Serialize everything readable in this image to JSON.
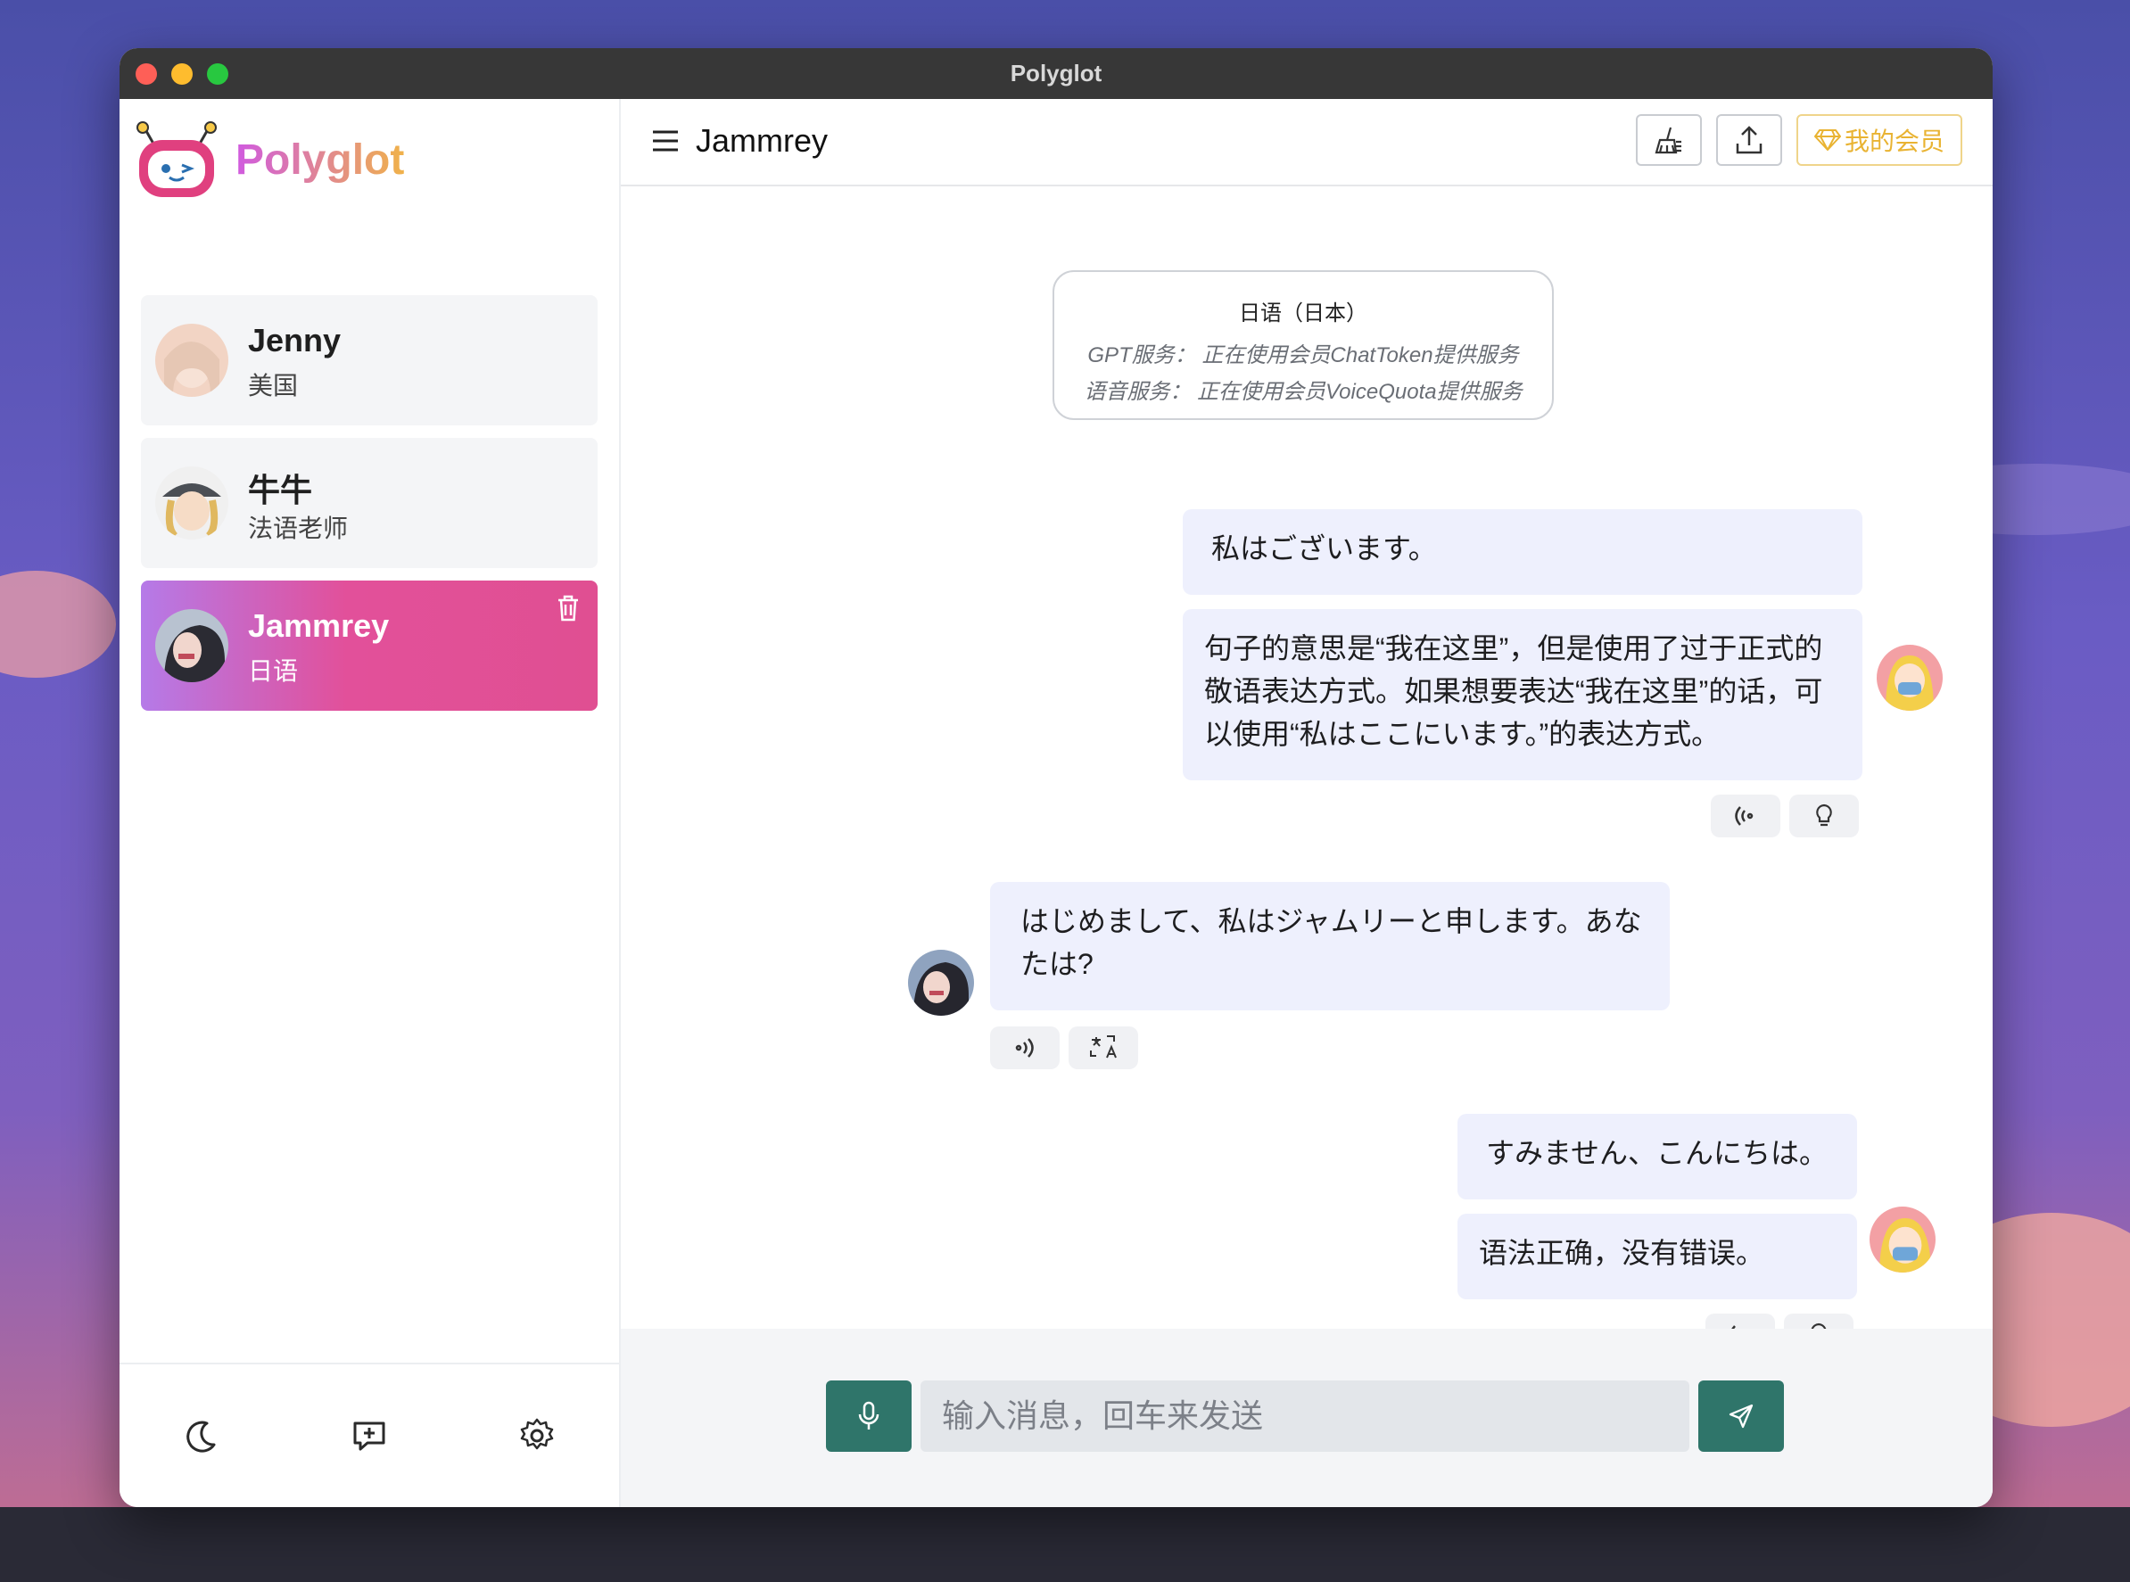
{
  "window": {
    "title": "Polyglot"
  },
  "app": {
    "logo_text": "Polyglot"
  },
  "contacts": [
    {
      "name": "Jenny",
      "subtitle": "美国"
    },
    {
      "name": "牛牛",
      "subtitle": "法语老师"
    },
    {
      "name": "Jammrey",
      "subtitle": "日语",
      "active": true
    }
  ],
  "header": {
    "chat_title": "Jammrey",
    "vip_label": "我的会员"
  },
  "info_card": {
    "language": "日语（日本）",
    "gpt_service": "GPT服务：  正在使用会员ChatToken提供服务",
    "voice_service": "语音服务：  正在使用会员VoiceQuota提供服务"
  },
  "messages": [
    {
      "role": "user",
      "text": "私はございます。"
    },
    {
      "role": "user",
      "text": "句子的意思是“我在这里”，但是使用了过于正式的敬语表达方式。如果想要表达“我在这里”的话，可以使用“私はここにいます。”的表达方式。"
    },
    {
      "role": "assistant",
      "text": "はじめまして、私はジャムリーと申します。あなたは?"
    },
    {
      "role": "user",
      "text": "すみません、こんにちは。"
    },
    {
      "role": "user",
      "text": "语法正确，没有错误。"
    }
  ],
  "composer": {
    "placeholder": "输入消息，回车来发送"
  },
  "colors": {
    "accent": "#2f756a",
    "active_contact_start": "#b57ae8",
    "active_contact_end": "#e04f92",
    "bubble": "#eef0fd",
    "vip": "#e9b332"
  }
}
